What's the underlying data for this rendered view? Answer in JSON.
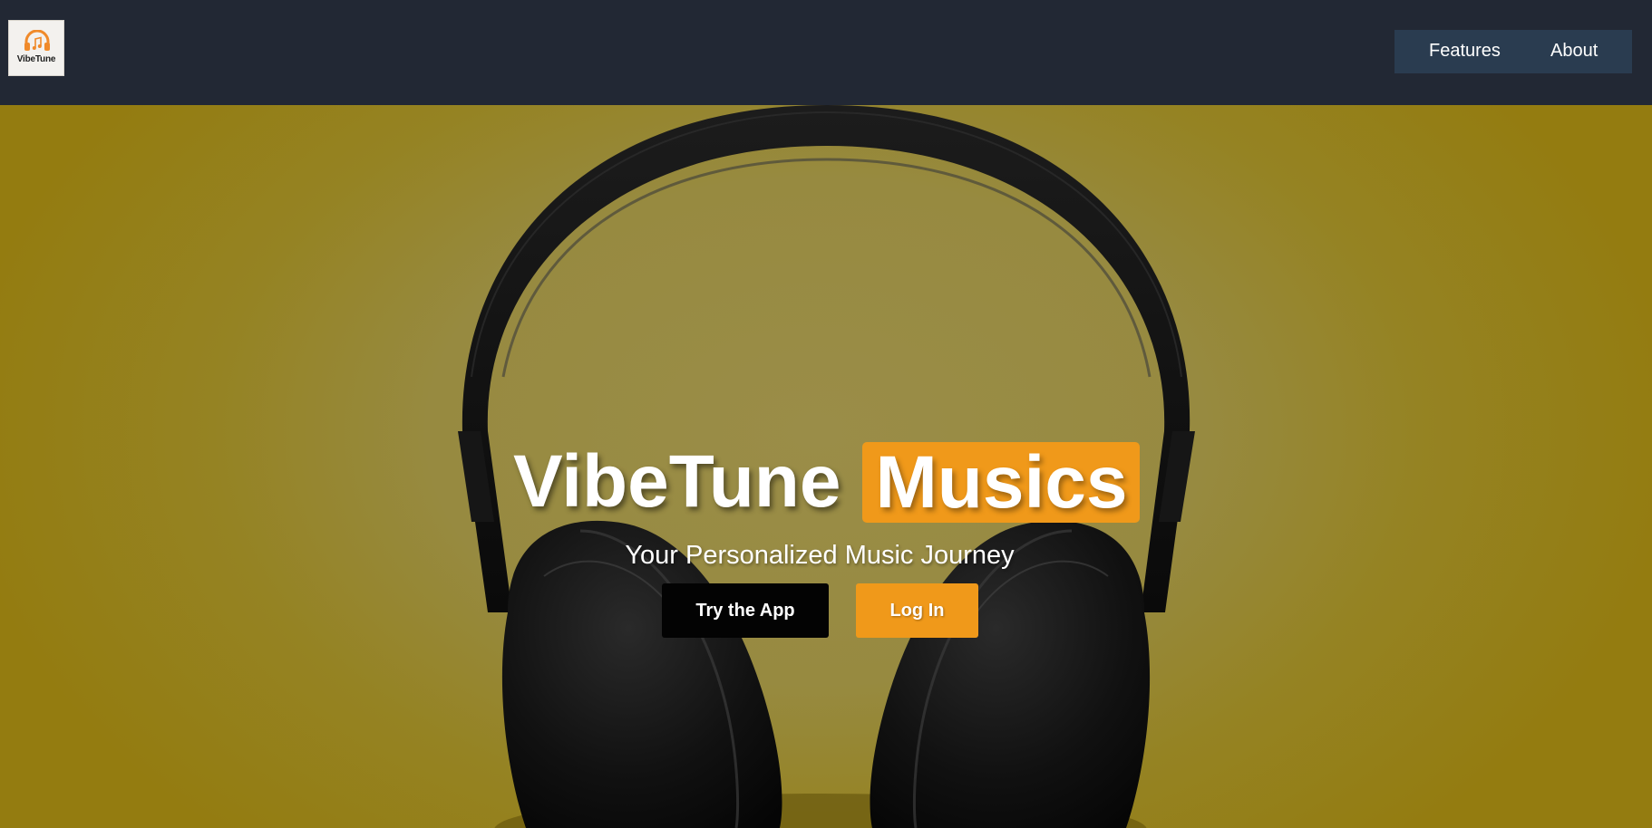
{
  "header": {
    "logo_text": "VibeTune",
    "nav": {
      "features_label": "Features",
      "about_label": "About"
    }
  },
  "hero": {
    "title_main": "VibeTune",
    "title_accent": "Musics",
    "subtitle": "Your Personalized Music Journey",
    "buttons": {
      "try_label": "Try the App",
      "login_label": "Log In"
    }
  },
  "colors": {
    "header_bg": "#222834",
    "nav_bg": "#2a3c50",
    "accent": "#f0991a",
    "hero_bg": "#978a40",
    "dark_button": "#030303"
  },
  "icons": {
    "logo": "headphones-music-note-icon",
    "hero_image": "headphones-photo"
  }
}
